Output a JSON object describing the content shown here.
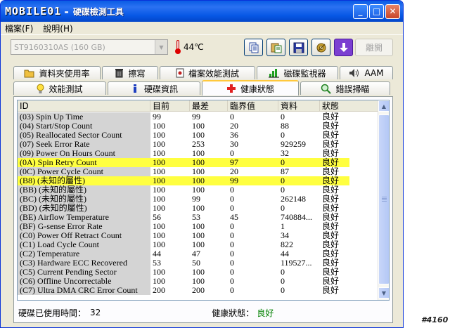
{
  "titlebar": {
    "logo": "MOBILE01",
    "separator": "-",
    "title": "硬碟檢測工具",
    "min": "_",
    "max": "□",
    "close": "✕"
  },
  "menu": {
    "file": "檔案(F)",
    "help": "說明(H)"
  },
  "toolbar": {
    "drive": "ST9160310AS (160 GB)",
    "temperature": "44℃",
    "disconnect": "離開",
    "icons": [
      "copy-icon",
      "paste-icon",
      "save-icon",
      "tools-icon",
      "download-icon"
    ]
  },
  "tabs_top": [
    "資料夾使用率",
    "擦寫",
    "檔案效能測試",
    "磁碟監視器",
    "AAM"
  ],
  "tabs_bottom": [
    "效能測試",
    "硬碟資訊",
    "健康狀態",
    "錯誤掃瞄"
  ],
  "active_tab": "健康狀態",
  "grid": {
    "columns": [
      "ID",
      "目前",
      "最差",
      "臨界值",
      "資料",
      "狀態"
    ],
    "rows": [
      {
        "id": "(03) Spin Up Time",
        "cur": "99",
        "worst": "99",
        "thr": "0",
        "data": "0",
        "status": "良好"
      },
      {
        "id": "(04) Start/Stop Count",
        "cur": "100",
        "worst": "100",
        "thr": "20",
        "data": "88",
        "status": "良好"
      },
      {
        "id": "(05) Reallocated Sector Count",
        "cur": "100",
        "worst": "100",
        "thr": "36",
        "data": "0",
        "status": "良好"
      },
      {
        "id": "(07) Seek Error Rate",
        "cur": "100",
        "worst": "253",
        "thr": "30",
        "data": "929259",
        "status": "良好"
      },
      {
        "id": "(09) Power On Hours Count",
        "cur": "100",
        "worst": "100",
        "thr": "0",
        "data": "32",
        "status": "良好"
      },
      {
        "id": "(0A) Spin Retry Count",
        "cur": "100",
        "worst": "100",
        "thr": "97",
        "data": "0",
        "status": "良好",
        "hl": true
      },
      {
        "id": "(0C) Power Cycle Count",
        "cur": "100",
        "worst": "100",
        "thr": "20",
        "data": "87",
        "status": "良好"
      },
      {
        "id": "(B8) (未知的屬性)",
        "cur": "100",
        "worst": "100",
        "thr": "99",
        "data": "0",
        "status": "良好",
        "hl": true
      },
      {
        "id": "(BB) (未知的屬性)",
        "cur": "100",
        "worst": "100",
        "thr": "0",
        "data": "0",
        "status": "良好"
      },
      {
        "id": "(BC) (未知的屬性)",
        "cur": "100",
        "worst": "99",
        "thr": "0",
        "data": "262148",
        "status": "良好"
      },
      {
        "id": "(BD) (未知的屬性)",
        "cur": "100",
        "worst": "100",
        "thr": "0",
        "data": "0",
        "status": "良好"
      },
      {
        "id": "(BE) Airflow Temperature",
        "cur": "56",
        "worst": "53",
        "thr": "45",
        "data": "740884...",
        "status": "良好"
      },
      {
        "id": "(BF) G-sense Error Rate",
        "cur": "100",
        "worst": "100",
        "thr": "0",
        "data": "1",
        "status": "良好"
      },
      {
        "id": "(C0) Power Off Retract Count",
        "cur": "100",
        "worst": "100",
        "thr": "0",
        "data": "34",
        "status": "良好"
      },
      {
        "id": "(C1) Load Cycle Count",
        "cur": "100",
        "worst": "100",
        "thr": "0",
        "data": "822",
        "status": "良好"
      },
      {
        "id": "(C2) Temperature",
        "cur": "44",
        "worst": "47",
        "thr": "0",
        "data": "44",
        "status": "良好"
      },
      {
        "id": "(C3) Hardware ECC Recovered",
        "cur": "53",
        "worst": "50",
        "thr": "0",
        "data": "119527...",
        "status": "良好"
      },
      {
        "id": "(C5) Current Pending Sector",
        "cur": "100",
        "worst": "100",
        "thr": "0",
        "data": "0",
        "status": "良好"
      },
      {
        "id": "(C6) Offline Uncorrectable",
        "cur": "100",
        "worst": "100",
        "thr": "0",
        "data": "0",
        "status": "良好"
      },
      {
        "id": "(C7) Ultra DMA CRC Error Count",
        "cur": "200",
        "worst": "200",
        "thr": "0",
        "data": "0",
        "status": "良好"
      }
    ]
  },
  "status": {
    "used_label": "硬碟已使用時間：",
    "used_value": "32",
    "health_label": "健康狀態：",
    "health_value": "良好",
    "health_color": "#008000"
  },
  "watermark": "#4160"
}
